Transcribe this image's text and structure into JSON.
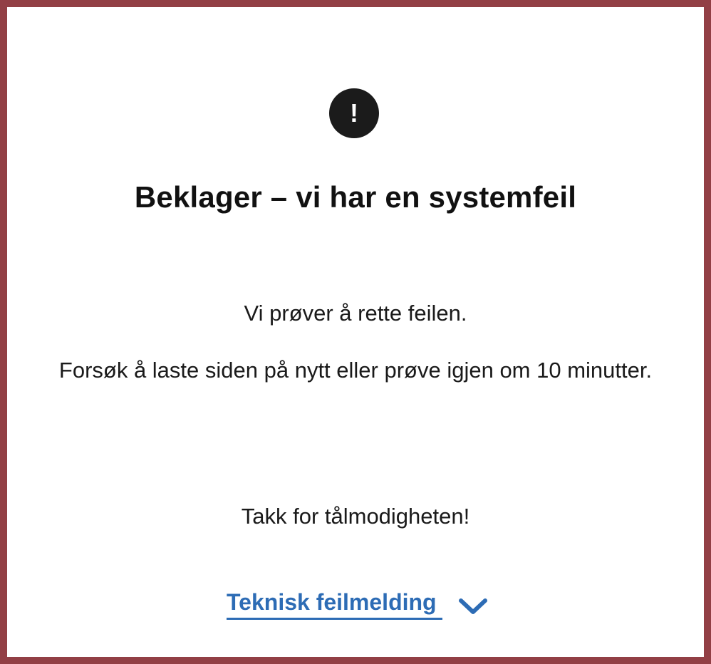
{
  "error": {
    "icon": "exclamation-circle-icon",
    "icon_glyph": "!",
    "title": "Beklager – vi har en systemfeil",
    "message_1": "Vi prøver å rette feilen.",
    "message_2": "Forsøk å laste siden på nytt eller prøve igjen om 10 minutter.",
    "thanks": "Takk for tålmodigheten!"
  },
  "technical": {
    "label": "Teknisk feilmelding",
    "expanded": false,
    "icon": "chevron-down-icon"
  },
  "colors": {
    "frame_border": "#923f45",
    "link": "#2d6cb5",
    "icon_bg": "#1b1b1b"
  }
}
